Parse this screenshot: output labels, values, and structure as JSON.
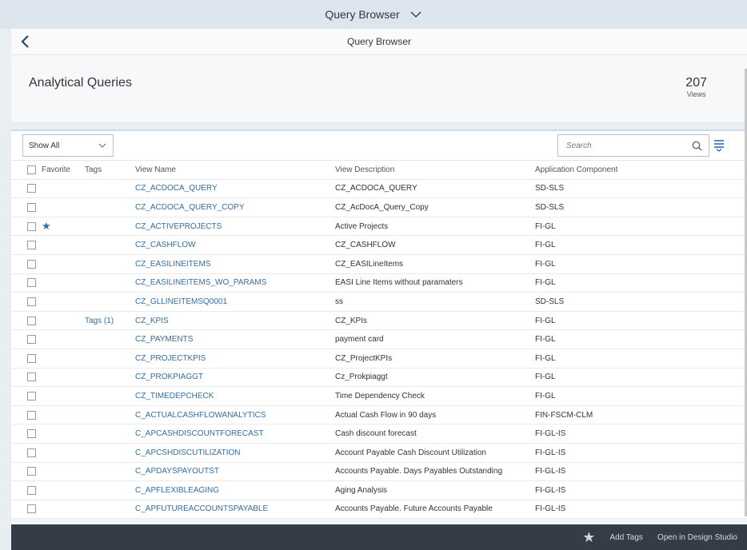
{
  "shell": {
    "title": "Query Browser"
  },
  "nav": {
    "title": "Query Browser"
  },
  "header": {
    "title": "Analytical Queries",
    "count": "207",
    "count_label": "Views"
  },
  "toolbar": {
    "filter_value": "Show All",
    "search_placeholder": "Search"
  },
  "columns": {
    "favorite": "Favorite",
    "tags": "Tags",
    "view_name": "View Name",
    "view_description": "View Description",
    "application_component": "Application Component"
  },
  "rows": [
    {
      "favorite": false,
      "tags": "",
      "name": "CZ_ACDOCA_QUERY",
      "description": "CZ_ACDOCA_QUERY",
      "component": "SD-SLS"
    },
    {
      "favorite": false,
      "tags": "",
      "name": "CZ_ACDOCA_QUERY_COPY",
      "description": "CZ_AcDocA_Query_Copy",
      "component": "SD-SLS"
    },
    {
      "favorite": true,
      "tags": "",
      "name": "CZ_ACTIVEPROJECTS",
      "description": "Active Projects",
      "component": "FI-GL"
    },
    {
      "favorite": false,
      "tags": "",
      "name": "CZ_CASHFLOW",
      "description": "CZ_CASHFLOW",
      "component": "FI-GL"
    },
    {
      "favorite": false,
      "tags": "",
      "name": "CZ_EASILINEITEMS",
      "description": "CZ_EASILineItems",
      "component": "FI-GL"
    },
    {
      "favorite": false,
      "tags": "",
      "name": "CZ_EASILINEITEMS_WO_PARAMS",
      "description": "EASI Line Items without paramaters",
      "component": "FI-GL"
    },
    {
      "favorite": false,
      "tags": "",
      "name": "CZ_GLLINEITEMSQ0001",
      "description": "ss",
      "component": "SD-SLS"
    },
    {
      "favorite": false,
      "tags": "Tags (1)",
      "name": "CZ_KPIS",
      "description": "CZ_KPIs",
      "component": "FI-GL"
    },
    {
      "favorite": false,
      "tags": "",
      "name": "CZ_PAYMENTS",
      "description": "payment card",
      "component": "FI-GL"
    },
    {
      "favorite": false,
      "tags": "",
      "name": "CZ_PROJECTKPIS",
      "description": "CZ_ProjectKPIs",
      "component": "FI-GL"
    },
    {
      "favorite": false,
      "tags": "",
      "name": "CZ_PROKPIAGGT",
      "description": "Cz_Prokpiaggt",
      "component": "FI-GL"
    },
    {
      "favorite": false,
      "tags": "",
      "name": "CZ_TIMEDEPCHECK",
      "description": "Time Dependency Check",
      "component": "FI-GL"
    },
    {
      "favorite": false,
      "tags": "",
      "name": "C_ACTUALCASHFLOWANALYTICS",
      "description": "Actual Cash Flow in 90 days",
      "component": "FIN-FSCM-CLM"
    },
    {
      "favorite": false,
      "tags": "",
      "name": "C_APCASHDISCOUNTFORECAST",
      "description": "Cash discount forecast",
      "component": "FI-GL-IS"
    },
    {
      "favorite": false,
      "tags": "",
      "name": "C_APCSHDISCUTILIZATION",
      "description": "Account Payable Cash Discount Utilization",
      "component": "FI-GL-IS"
    },
    {
      "favorite": false,
      "tags": "",
      "name": "C_APDAYSPAYOUTST",
      "description": "Accounts Payable. Days Payables Outstanding",
      "component": "FI-GL-IS"
    },
    {
      "favorite": false,
      "tags": "",
      "name": "C_APFLEXIBLEAGING",
      "description": "Aging Analysis",
      "component": "FI-GL-IS"
    },
    {
      "favorite": false,
      "tags": "",
      "name": "C_APFUTUREACCOUNTSPAYABLE",
      "description": "Accounts Payable. Future Accounts Payable",
      "component": "FI-GL-IS"
    }
  ],
  "footer": {
    "add_tags": "Add Tags",
    "open_design_studio": "Open in Design Studio"
  },
  "colors": {
    "link": "#346da3",
    "star": "#2a6db0",
    "footer_bg": "#343c45",
    "shell_bg": "#dde6ee"
  }
}
